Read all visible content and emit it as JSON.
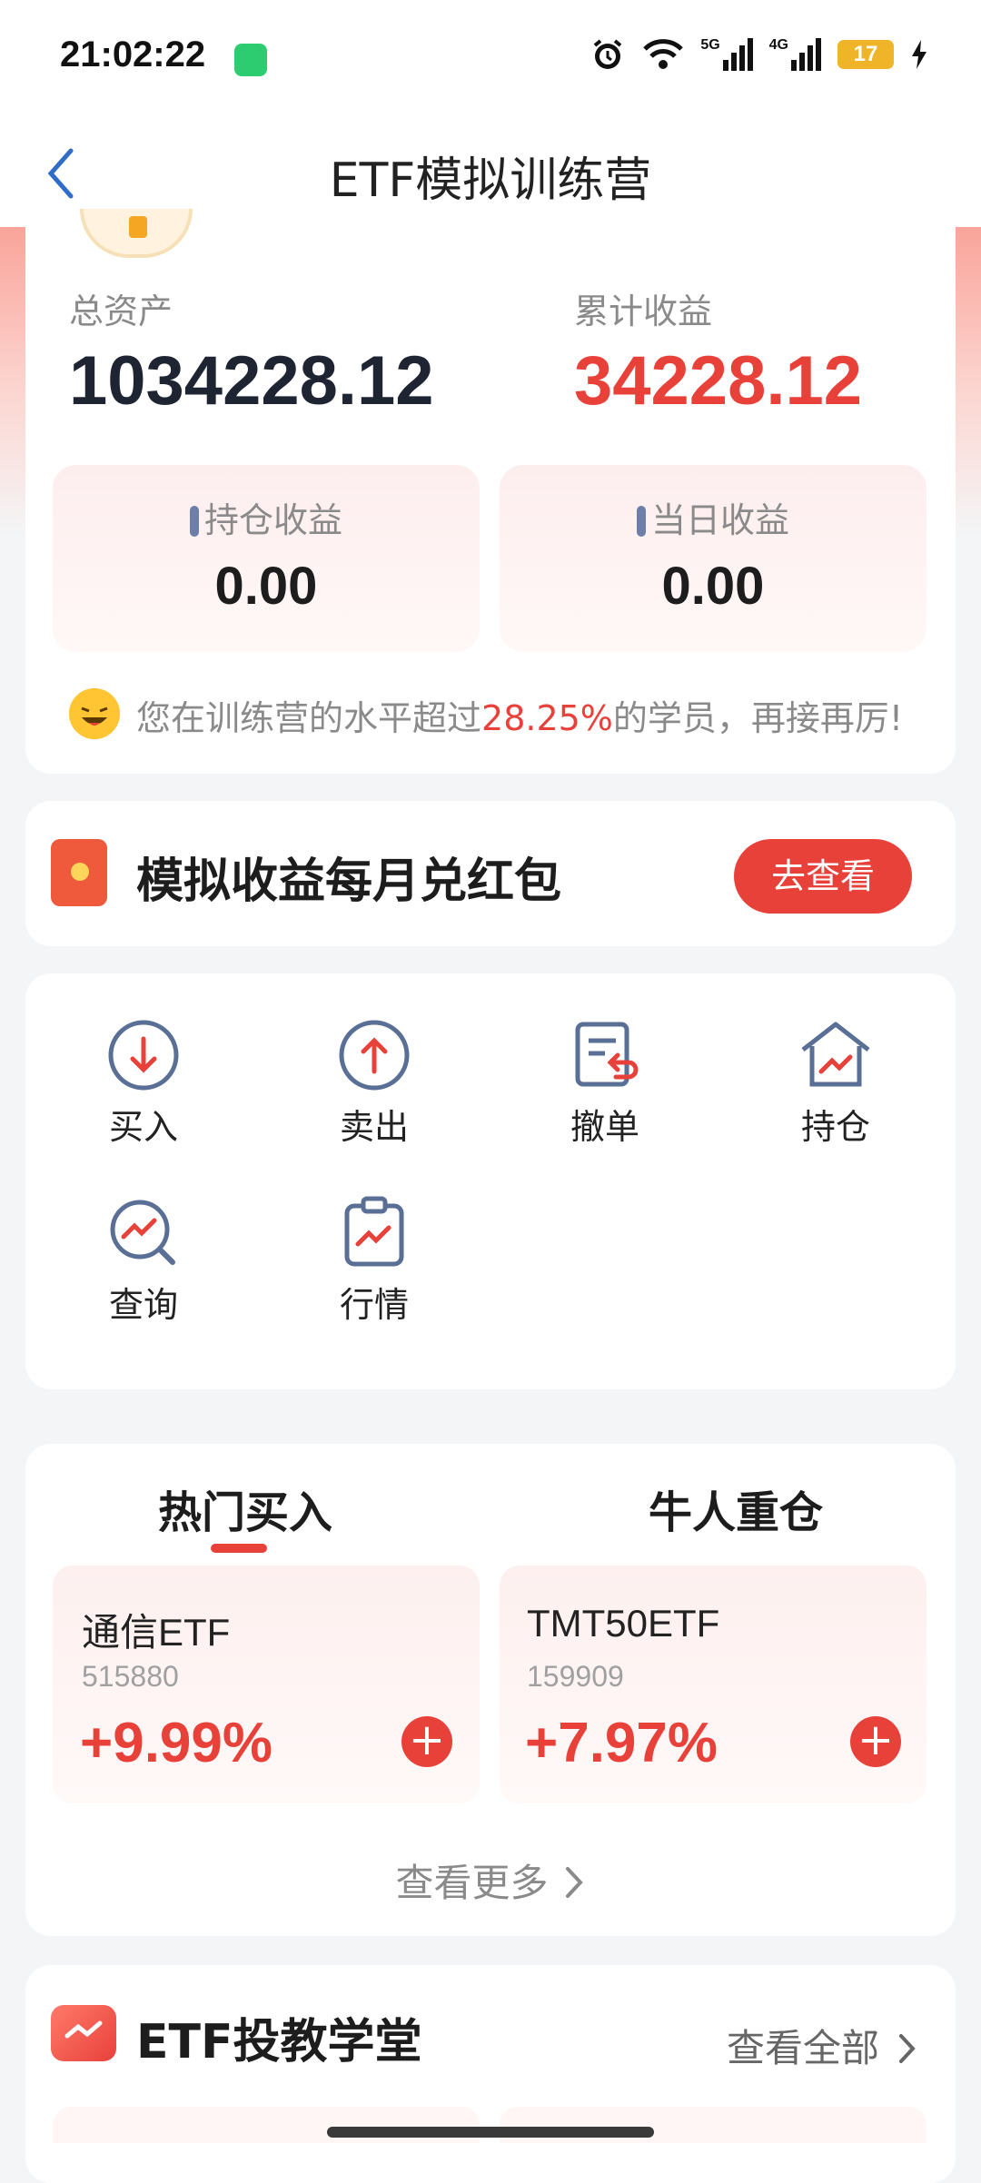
{
  "status": {
    "time": "21:02:22",
    "sig1": "5G",
    "sig2": "4G",
    "battery": "17"
  },
  "header": {
    "title": "ETF模拟训练营"
  },
  "assets": {
    "total_label": "总资产",
    "total_value": "1034228.12",
    "cum_label": "累计收益",
    "cum_value": "34228.12",
    "hold_label": "持仓收益",
    "hold_value": "0.00",
    "day_label": "当日收益",
    "day_value": "0.00",
    "rank_prefix": "您在训练营的水平超过",
    "rank_pct": "28.25%",
    "rank_suffix": "的学员，再接再厉!"
  },
  "promo": {
    "text": "模拟收益每月兑红包",
    "button": "去查看"
  },
  "actions": [
    {
      "label": "买入",
      "icon": "buy-icon"
    },
    {
      "label": "卖出",
      "icon": "sell-icon"
    },
    {
      "label": "撤单",
      "icon": "cancel-order-icon"
    },
    {
      "label": "持仓",
      "icon": "holdings-icon"
    },
    {
      "label": "查询",
      "icon": "query-icon"
    },
    {
      "label": "行情",
      "icon": "market-icon"
    }
  ],
  "hot": {
    "tabs": [
      "热门买入",
      "牛人重仓"
    ],
    "funds": [
      {
        "name": "通信ETF",
        "code": "515880",
        "pct": "+9.99%"
      },
      {
        "name": "TMT50ETF",
        "code": "159909",
        "pct": "+7.97%"
      }
    ],
    "more": "查看更多"
  },
  "school": {
    "title": "ETF投教学堂",
    "all": "查看全部"
  },
  "colors": {
    "accent": "#e8413a",
    "label": "#8a8a8a"
  }
}
